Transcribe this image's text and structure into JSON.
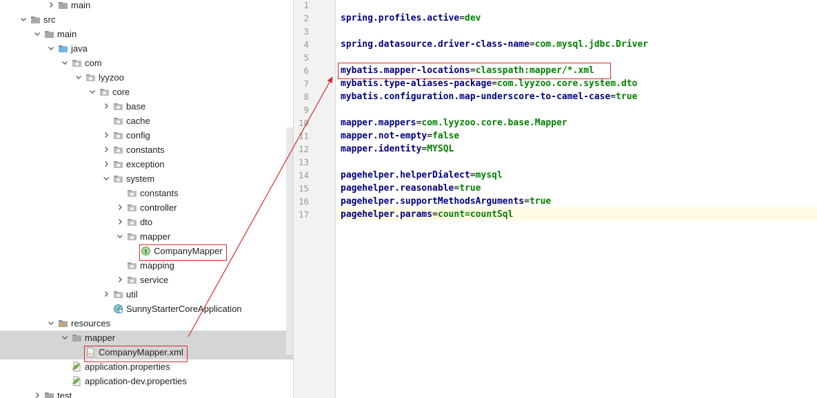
{
  "tree": {
    "items": [
      {
        "label": "main",
        "icon": "folder",
        "arrow": "collapsed",
        "cut": true
      },
      {
        "label": "src",
        "icon": "folder",
        "arrow": "expanded"
      },
      {
        "label": "main",
        "icon": "folder",
        "arrow": "expanded"
      },
      {
        "label": "java",
        "icon": "source-folder",
        "arrow": "expanded"
      },
      {
        "label": "com",
        "icon": "package",
        "arrow": "expanded"
      },
      {
        "label": "lyyzoo",
        "icon": "package",
        "arrow": "expanded"
      },
      {
        "label": "core",
        "icon": "package",
        "arrow": "expanded"
      },
      {
        "label": "base",
        "icon": "package",
        "arrow": "collapsed"
      },
      {
        "label": "cache",
        "icon": "package",
        "arrow": "none"
      },
      {
        "label": "config",
        "icon": "package",
        "arrow": "collapsed"
      },
      {
        "label": "constants",
        "icon": "package",
        "arrow": "collapsed"
      },
      {
        "label": "exception",
        "icon": "package",
        "arrow": "collapsed"
      },
      {
        "label": "system",
        "icon": "package",
        "arrow": "expanded"
      },
      {
        "label": "constants",
        "icon": "package",
        "arrow": "none"
      },
      {
        "label": "controller",
        "icon": "package",
        "arrow": "collapsed"
      },
      {
        "label": "dto",
        "icon": "package",
        "arrow": "collapsed"
      },
      {
        "label": "mapper",
        "icon": "package",
        "arrow": "expanded"
      },
      {
        "label": "CompanyMapper",
        "icon": "interface",
        "arrow": "none",
        "boxed": true
      },
      {
        "label": "mapping",
        "icon": "package",
        "arrow": "none"
      },
      {
        "label": "service",
        "icon": "package",
        "arrow": "collapsed"
      },
      {
        "label": "util",
        "icon": "package",
        "arrow": "collapsed"
      },
      {
        "label": "SunnyStarterCoreApplication",
        "icon": "spring-app",
        "arrow": "none"
      },
      {
        "label": "resources",
        "icon": "resources-folder",
        "arrow": "expanded"
      },
      {
        "label": "mapper",
        "icon": "folder",
        "arrow": "expanded",
        "selected": true
      },
      {
        "label": "CompanyMapper.xml",
        "icon": "xml-file",
        "arrow": "none",
        "selected": true,
        "boxed": true
      },
      {
        "label": "application.properties",
        "icon": "spring-properties",
        "arrow": "none"
      },
      {
        "label": "application-dev.properties",
        "icon": "spring-properties",
        "arrow": "none"
      },
      {
        "label": "test",
        "icon": "folder",
        "arrow": "collapsed"
      }
    ]
  },
  "editor": {
    "caret_line": 17,
    "lines": [
      {
        "n": "1",
        "key": "",
        "val": ""
      },
      {
        "n": "2",
        "key": "spring.profiles.active",
        "val": "dev"
      },
      {
        "n": "3",
        "key": "",
        "val": ""
      },
      {
        "n": "4",
        "key": "spring.datasource.driver-class-name",
        "val": "com.mysql.jdbc.Driver"
      },
      {
        "n": "5",
        "key": "",
        "val": ""
      },
      {
        "n": "6",
        "key": "mybatis.mapper-locations",
        "val": "classpath:mapper/*.xml",
        "boxed": true
      },
      {
        "n": "7",
        "key": "mybatis.type-aliases-package",
        "val": "com.lyyzoo.core.system.dto"
      },
      {
        "n": "8",
        "key": "mybatis.configuration.map-underscore-to-camel-case",
        "val": "true"
      },
      {
        "n": "9",
        "key": "",
        "val": ""
      },
      {
        "n": "10",
        "key": "mapper.mappers",
        "val": "com.lyyzoo.core.base.Mapper"
      },
      {
        "n": "11",
        "key": "mapper.not-empty",
        "val": "false"
      },
      {
        "n": "12",
        "key": "mapper.identity",
        "val": "MYSQL"
      },
      {
        "n": "13",
        "key": "",
        "val": ""
      },
      {
        "n": "14",
        "key": "pagehelper.helperDialect",
        "val": "mysql"
      },
      {
        "n": "15",
        "key": "pagehelper.reasonable",
        "val": "true"
      },
      {
        "n": "16",
        "key": "pagehelper.supportMethodsArguments",
        "val": "true"
      },
      {
        "n": "17",
        "key": "pagehelper.params",
        "val": "count=countSql"
      }
    ]
  },
  "colors": {
    "annotation": "#d42b2b",
    "key": "#000080",
    "value": "#008000",
    "selection": "#d5d5d5",
    "caret_line": "#fffae3"
  }
}
